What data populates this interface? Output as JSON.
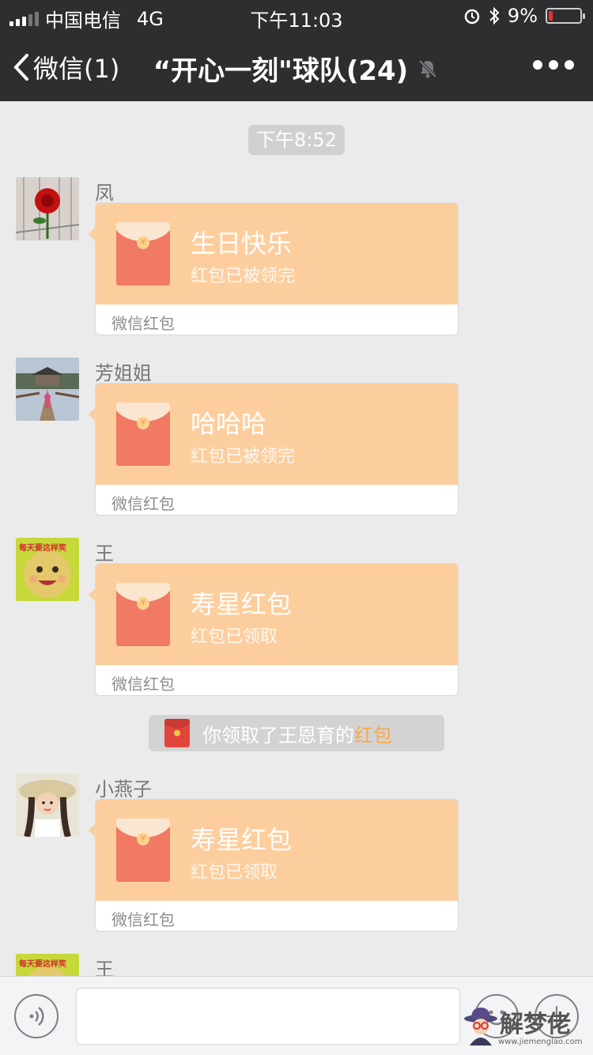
{
  "status_bar": {
    "carrier": "中国电信",
    "network": "4G",
    "time": "下午11:03",
    "battery": "9%"
  },
  "nav": {
    "back_label": "微信(1)",
    "title": "“开心一刻\"球队(24)"
  },
  "chat": {
    "timestamp": "下午8:52",
    "messages": [
      {
        "sender": "凤",
        "title": "生日快乐",
        "status": "红包已被领完",
        "footer": "微信红包"
      },
      {
        "sender": "芳姐姐",
        "title": "哈哈哈",
        "status": "红包已被领完",
        "footer": "微信红包"
      },
      {
        "sender": "王",
        "title": "寿星红包",
        "status": "红包已领取",
        "footer": "微信红包"
      },
      {
        "sender": "小燕子",
        "title": "寿星红包",
        "status": "红包已领取",
        "footer": "微信红包"
      },
      {
        "sender": "王"
      }
    ],
    "system_message": {
      "text": "你领取了王恩育的",
      "highlight": "红包"
    },
    "avatar_caption": "每天要这样笑"
  },
  "watermark": {
    "text": "解梦佬",
    "url": "www.jiemenglao.com"
  },
  "colors": {
    "nav_bg": "#2e2e30",
    "chat_bg": "#ebebeb",
    "packet_bg": "#fdce9d",
    "envelope": "#f07a63",
    "highlight": "#f7a84a"
  }
}
